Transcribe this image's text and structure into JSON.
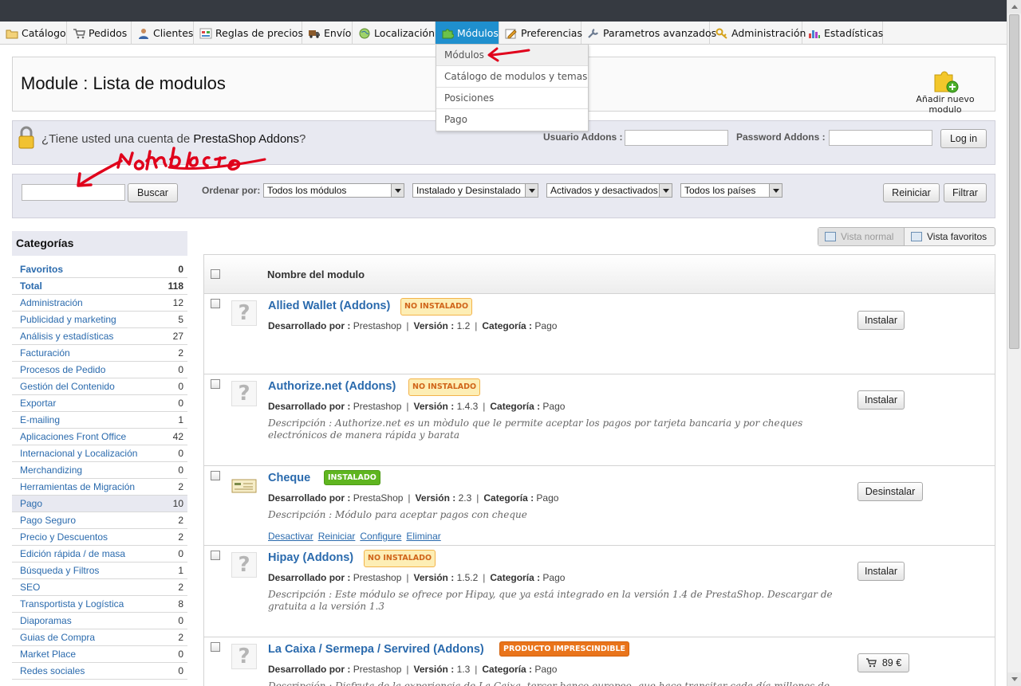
{
  "menu": {
    "tabs": [
      {
        "label": "Catálogo",
        "icon": "folder-icon"
      },
      {
        "label": "Pedidos",
        "icon": "cart-icon"
      },
      {
        "label": "Clientes",
        "icon": "user-icon"
      },
      {
        "label": "Reglas de precios",
        "icon": "price-rules-icon"
      },
      {
        "label": "Envío",
        "icon": "truck-icon"
      },
      {
        "label": "Localización",
        "icon": "globe-icon"
      },
      {
        "label": "Módulos",
        "icon": "puzzle-icon"
      },
      {
        "label": "Preferencias",
        "icon": "preferences-icon"
      },
      {
        "label": "Parametros avanzados",
        "icon": "wrench-icon"
      },
      {
        "label": "Administración",
        "icon": "key-icon"
      },
      {
        "label": "Estadísticas",
        "icon": "stats-icon"
      }
    ],
    "active_tab": "Módulos",
    "dropdown": [
      "Módulos",
      "Catálogo de modulos y temas",
      "Posiciones",
      "Pago"
    ]
  },
  "header": {
    "title": "Module : Lista de modulos",
    "add_module_label": "Añadir nuevo modulo"
  },
  "addons": {
    "question_prefix": "¿Tiene usted una cuenta de ",
    "question_brand": "PrestaShop Addons",
    "question_suffix": "?",
    "user_label": "Usuario Addons :",
    "password_label": "Password Addons :",
    "login_label": "Log in"
  },
  "filter": {
    "search_label": "Buscar",
    "sort_label": "Ordenar por:",
    "selects": [
      "Todos los módulos",
      "Instalado y Desinstalado",
      "Activados y desactivados",
      "Todos los países"
    ],
    "reset_label": "Reiniciar",
    "filter_label": "Filtrar"
  },
  "categories": {
    "title": "Categorías",
    "items": [
      {
        "label": "Favoritos",
        "count": "0",
        "bold": true
      },
      {
        "label": "Total",
        "count": "118",
        "bold": true
      },
      {
        "label": "Administración",
        "count": "12"
      },
      {
        "label": "Publicidad y marketing",
        "count": "5"
      },
      {
        "label": "Análisis y estadísticas",
        "count": "27"
      },
      {
        "label": "Facturación",
        "count": "2"
      },
      {
        "label": "Procesos de Pedido",
        "count": "0"
      },
      {
        "label": "Gestión del Contenido",
        "count": "0"
      },
      {
        "label": "Exportar",
        "count": "0"
      },
      {
        "label": "E-mailing",
        "count": "1"
      },
      {
        "label": "Aplicaciones Front Office",
        "count": "42"
      },
      {
        "label": "Internacional y Localización",
        "count": "0"
      },
      {
        "label": "Merchandizing",
        "count": "0"
      },
      {
        "label": "Herramientas de Migración",
        "count": "2"
      },
      {
        "label": "Pago",
        "count": "10",
        "active": true
      },
      {
        "label": "Pago Seguro",
        "count": "2"
      },
      {
        "label": "Precio y Descuentos",
        "count": "2"
      },
      {
        "label": "Edición rápida / de masa",
        "count": "0"
      },
      {
        "label": "Búsqueda y Filtros",
        "count": "1"
      },
      {
        "label": "SEO",
        "count": "2"
      },
      {
        "label": "Transportista y Logística",
        "count": "8"
      },
      {
        "label": "Diaporamas",
        "count": "0"
      },
      {
        "label": "Guias de Compra",
        "count": "2"
      },
      {
        "label": "Market Place",
        "count": "0"
      },
      {
        "label": "Redes sociales",
        "count": "0"
      }
    ]
  },
  "view": {
    "normal_label": "Vista normal",
    "favorites_label": "Vista favoritos"
  },
  "table": {
    "header": "Nombre del modulo",
    "labels": {
      "developer": "Desarrollado por :",
      "version": "Versión :",
      "category": "Categoría :"
    },
    "modules": [
      {
        "name": "Allied Wallet (Addons)",
        "badge": "NO INSTALADO",
        "badge_type": "not",
        "developer": "Prestashop",
        "version": "1.2",
        "category": "Pago",
        "description": "",
        "action": "Instalar",
        "links": []
      },
      {
        "name": "Authorize.net (Addons)",
        "badge": "NO INSTALADO",
        "badge_type": "not",
        "developer": "Prestashop",
        "version": "1.4.3",
        "category": "Pago",
        "description": "Descripción : Authorize.net es un mòdulo que le permite aceptar los pagos por tarjeta bancaria y por cheques electrónicos de manera rápida y barata",
        "action": "Instalar",
        "links": []
      },
      {
        "name": "Cheque",
        "badge": "INSTALADO",
        "badge_type": "ok",
        "developer": "PrestaShop",
        "version": "2.3",
        "category": "Pago",
        "description": "Descripción : Módulo para aceptar pagos con cheque",
        "action": "Desinstalar",
        "links": [
          "Desactivar",
          "Reiniciar",
          "Configure",
          "Eliminar"
        ]
      },
      {
        "name": "Hipay (Addons)",
        "badge": "NO INSTALADO",
        "badge_type": "not",
        "developer": "Prestashop",
        "version": "1.5.2",
        "category": "Pago",
        "description": "Descripción : Este módulo se ofrece por Hipay, que ya está integrado en la versión 1.4 de PrestaShop. Descargar de gratuita a la versión 1.3",
        "action": "Instalar",
        "links": []
      },
      {
        "name": "La Caixa / Sermepa / Servired (Addons)",
        "badge": "PRODUCTO IMPRESCINDIBLE",
        "badge_type": "must",
        "developer": "Prestashop",
        "version": "1.3",
        "category": "Pago",
        "description": "Descripción : Disfruta de la experiencia de La Caixa, tercer banco europeo, que hace transitar cada día millones de transacciones",
        "action": "89 €",
        "links": []
      }
    ]
  },
  "colors": {
    "accent": "#1f8fce",
    "link": "#2a6aad",
    "panel": "#e8e9f1",
    "topbar": "#363a41",
    "annotation": "#e0001b"
  }
}
